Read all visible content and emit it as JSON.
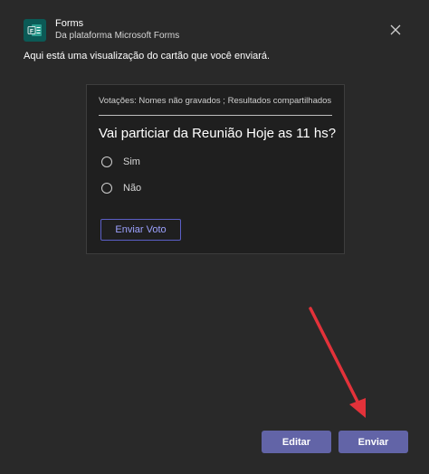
{
  "header": {
    "app_name": "Forms",
    "app_subtitle": "Da plataforma Microsoft Forms",
    "icon": "forms-icon",
    "close_icon": "close-icon"
  },
  "preview_caption": "Aqui está uma visualização do cartão que você enviará.",
  "card": {
    "meta": "Votações: Nomes não gravados ; Resultados compartilhados",
    "question": "Vai particiar da Reunião Hoje as 11 hs?",
    "options": [
      "Sim",
      "Não"
    ],
    "vote_button": "Enviar Voto"
  },
  "footer": {
    "edit_label": "Editar",
    "send_label": "Enviar"
  },
  "colors": {
    "accent": "#6264a7",
    "annotation_arrow": "#e3323a"
  }
}
